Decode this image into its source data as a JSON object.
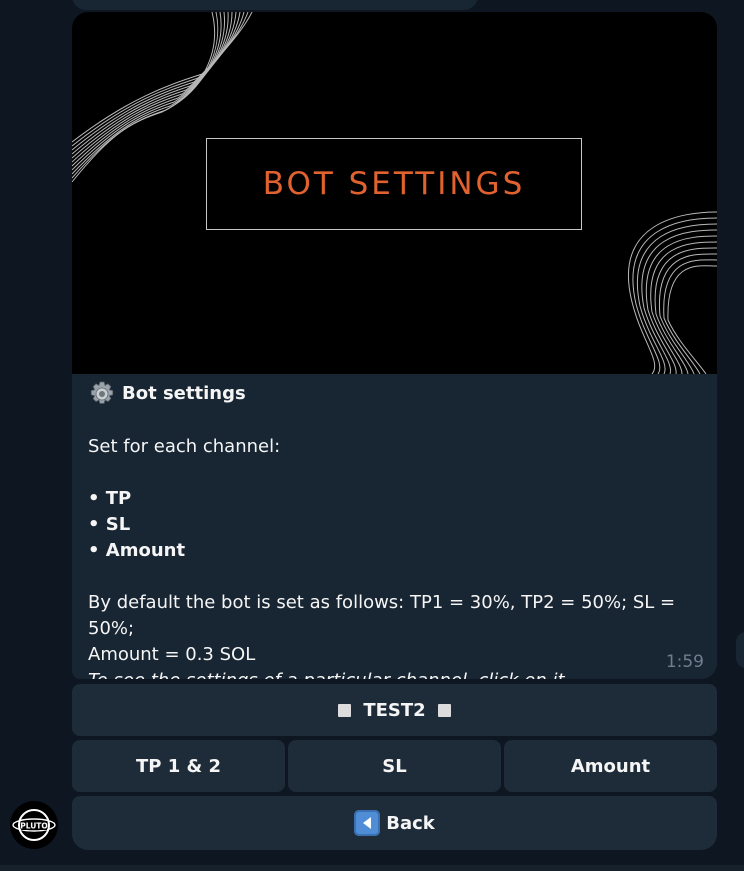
{
  "message": {
    "banner_title": "BOT SETTINGS",
    "heading": "Bot settings",
    "intro": "Set for each channel:",
    "bullets": [
      "• TP",
      "• SL",
      "• Amount"
    ],
    "defaults_line1": "By default the bot is set as follows: TP1 = 30%, TP2 = 50%; SL = 50%;",
    "defaults_line2": "Amount = 0.3 SOL",
    "hint": "To see the settings of a particular channel, click on it.",
    "time": "1:59"
  },
  "keyboard": {
    "channel_label": "TEST2",
    "tp_label": "TP 1 & 2",
    "sl_label": "SL",
    "amount_label": "Amount",
    "back_label": "Back"
  },
  "avatar": {
    "text": "PLUTO"
  },
  "icons": {
    "heading_icon": "gear-icon",
    "back_icon": "back-arrow-icon",
    "channel_markers": "white-square-icon"
  },
  "colors": {
    "background": "#0e1621",
    "bubble": "#182533",
    "button": "#1e2c3a",
    "banner_accent": "#e1612f",
    "timestamp": "#6d7f8f"
  }
}
